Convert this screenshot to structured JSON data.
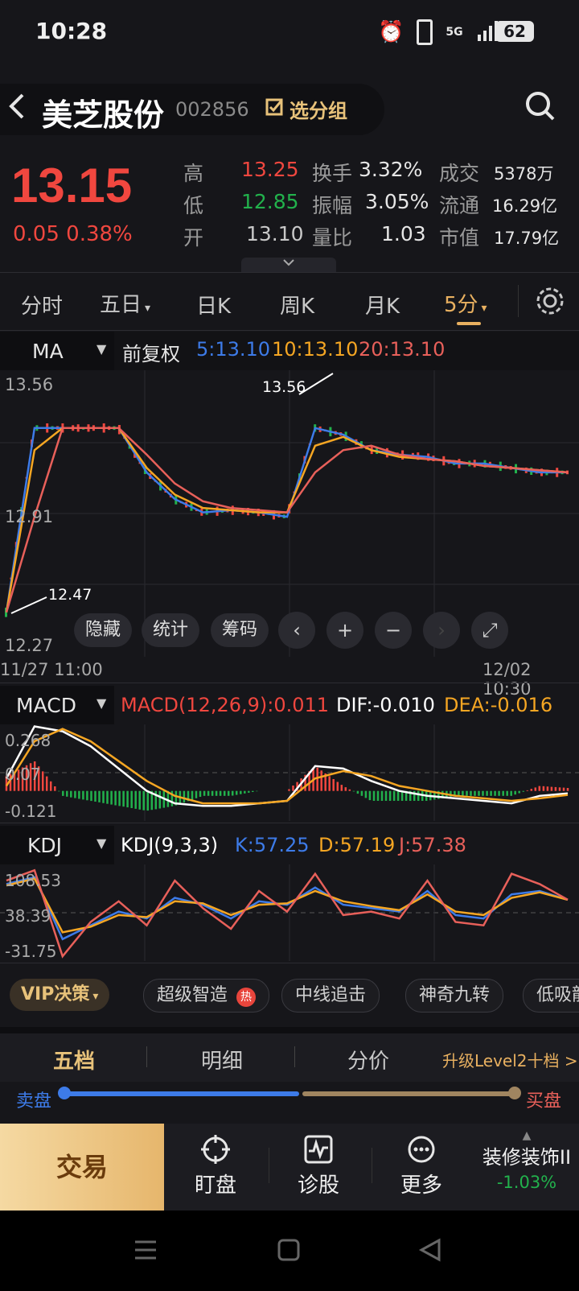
{
  "status": {
    "time": "10:28",
    "battery": "62",
    "network": "5G"
  },
  "header": {
    "name": "美芝股份",
    "code": "002856",
    "watch_label": "选分组"
  },
  "quote": {
    "price": "13.15",
    "change": "0.05",
    "change_pct": "0.38%",
    "high_label": "高",
    "high": "13.25",
    "low_label": "低",
    "low": "12.85",
    "open_label": "开",
    "open": "13.10",
    "turnover_label": "换手",
    "turnover": "3.32%",
    "amplitude_label": "振幅",
    "amplitude": "3.05%",
    "volume_ratio_label": "量比",
    "volume_ratio": "1.03",
    "amount_label": "成交",
    "amount": "5378万",
    "float_label": "流通",
    "float": "16.29亿",
    "mcap_label": "市值",
    "mcap": "17.79亿"
  },
  "tabs": [
    "分时",
    "五日",
    "日K",
    "周K",
    "月K",
    "5分"
  ],
  "active_tab": "5分",
  "ma": {
    "selector": "MA",
    "adjust": "前复权",
    "ma5": "5:13.10",
    "ma10": "10:13.10",
    "ma20": "20:13.10",
    "y_top": "13.56",
    "y_mid": "12.91",
    "y_bottom": "12.27",
    "peak_label": "13.56",
    "low_label": "12.47",
    "x_start": "11/27 11:00",
    "x_end": "12/02 10:30"
  },
  "chart_buttons": [
    "隐藏",
    "统计",
    "筹码"
  ],
  "macd": {
    "selector": "MACD",
    "params": "MACD(12,26,9):0.011",
    "dif": "DIF:-0.010",
    "dea": "DEA:-0.016",
    "y_top": "0.268",
    "y_mid": "0.07",
    "y_bottom": "-0.121"
  },
  "kdj": {
    "selector": "KDJ",
    "params": "KDJ(9,3,3)",
    "k": "K:57.25",
    "d": "D:57.19",
    "j": "J:57.38",
    "y_top": "108.53",
    "y_mid": "38.39",
    "y_bottom": "-31.75"
  },
  "chips": [
    "超级智造",
    "中线追击",
    "神奇九转",
    "低吸龍"
  ],
  "vip_label": "VIP决策",
  "hot_badge": "热",
  "order_tabs": [
    "五档",
    "明细",
    "分价"
  ],
  "upgrade_label": "升级Level2十档 >",
  "sell_label": "卖盘",
  "buy_label": "买盘",
  "bottom": {
    "trade": "交易",
    "watch": "盯盘",
    "diagnose": "诊股",
    "more": "更多",
    "sector": "装修装饰II",
    "sector_change": "-1.03%"
  },
  "colors": {
    "up": "#f0473f",
    "down": "#22b14c",
    "ma5": "#3d7be8",
    "ma10": "#f5a623",
    "ma20": "#e8605a",
    "accent": "#e8b060"
  },
  "chart_data": [
    {
      "type": "line",
      "x": [
        0,
        5,
        10,
        15,
        20,
        25,
        30,
        35,
        40,
        45,
        50,
        55,
        60,
        65,
        70,
        75,
        80,
        85,
        90,
        95,
        100
      ],
      "series": [
        {
          "values": [
            12.47,
            13.3,
            13.3,
            13.3,
            13.3,
            13.1,
            12.98,
            12.92,
            12.93,
            12.92,
            12.9,
            13.3,
            13.27,
            13.2,
            13.18,
            13.17,
            13.14,
            13.14,
            13.12,
            13.1,
            13.1
          ]
        },
        {
          "values": [
            12.47,
            13.2,
            13.3,
            13.3,
            13.3,
            13.12,
            13.0,
            12.94,
            12.93,
            12.92,
            12.92,
            13.22,
            13.26,
            13.2,
            13.17,
            13.16,
            13.15,
            13.13,
            13.12,
            13.11,
            13.1
          ]
        },
        {
          "values": [
            12.47,
            12.9,
            13.3,
            13.3,
            13.3,
            13.18,
            13.05,
            12.97,
            12.94,
            12.93,
            12.92,
            13.1,
            13.2,
            13.22,
            13.18,
            13.16,
            13.15,
            13.13,
            13.12,
            13.11,
            13.1
          ]
        }
      ],
      "ylim": [
        12.27,
        13.56
      ]
    },
    {
      "type": "line",
      "x": [
        0,
        5,
        10,
        15,
        20,
        25,
        30,
        35,
        40,
        45,
        50,
        55,
        60,
        65,
        70,
        75,
        80,
        85,
        90,
        95,
        100
      ],
      "series": [
        {
          "values": [
            0.05,
            0.26,
            0.24,
            0.18,
            0.09,
            0.0,
            -0.05,
            -0.06,
            -0.06,
            -0.05,
            -0.04,
            0.1,
            0.09,
            0.04,
            0.0,
            -0.02,
            -0.03,
            -0.04,
            -0.05,
            -0.02,
            -0.01
          ]
        },
        {
          "values": [
            0.02,
            0.2,
            0.25,
            0.2,
            0.12,
            0.04,
            -0.02,
            -0.05,
            -0.05,
            -0.05,
            -0.04,
            0.05,
            0.08,
            0.06,
            0.02,
            0.0,
            -0.02,
            -0.03,
            -0.04,
            -0.03,
            -0.016
          ]
        }
      ],
      "ylim": [
        -0.121,
        0.268
      ]
    },
    {
      "type": "line",
      "x": [
        0,
        5,
        10,
        15,
        20,
        25,
        30,
        35,
        40,
        45,
        50,
        55,
        60,
        65,
        70,
        75,
        80,
        85,
        90,
        95,
        100
      ],
      "series": [
        {
          "values": [
            80,
            90,
            0,
            20,
            40,
            30,
            60,
            50,
            30,
            55,
            50,
            75,
            50,
            45,
            40,
            70,
            35,
            30,
            65,
            70,
            57.25
          ]
        },
        {
          "values": [
            78,
            88,
            10,
            18,
            35,
            32,
            55,
            52,
            35,
            50,
            52,
            70,
            55,
            48,
            42,
            65,
            40,
            35,
            60,
            68,
            57.19
          ]
        },
        {
          "values": [
            85,
            100,
            -25,
            25,
            55,
            20,
            85,
            45,
            15,
            70,
            40,
            95,
            35,
            40,
            30,
            85,
            25,
            20,
            95,
            80,
            57.38
          ]
        }
      ],
      "ylim": [
        -31.75,
        108.53
      ]
    }
  ]
}
